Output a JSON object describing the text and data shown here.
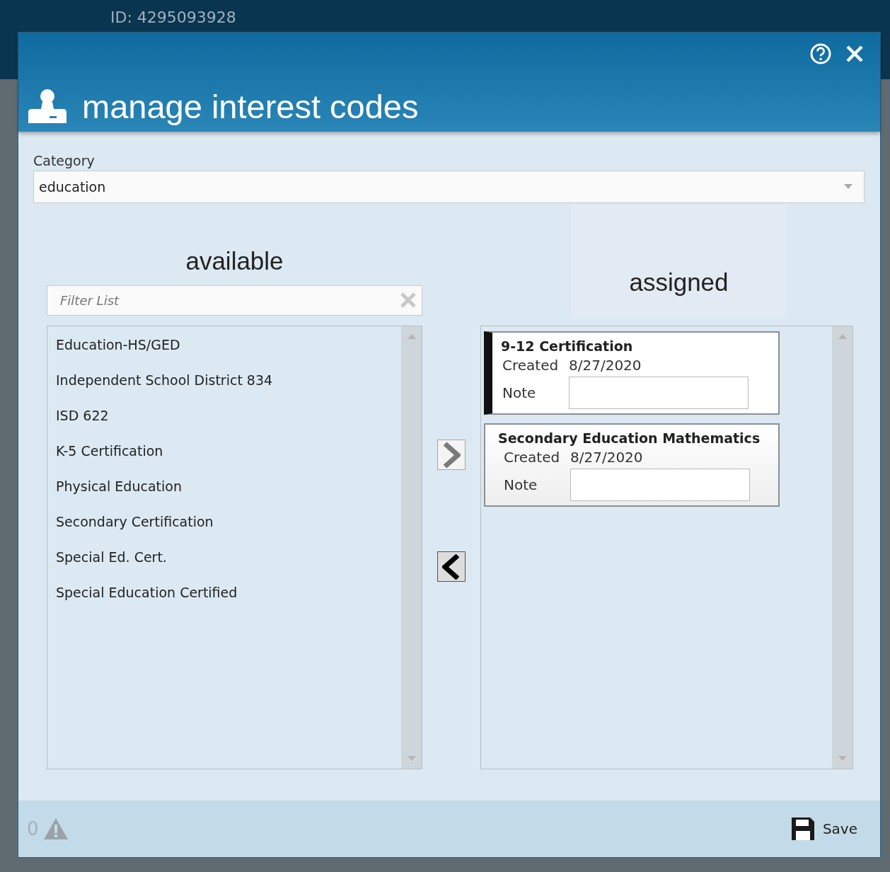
{
  "background": {
    "id_label": "ID: 4295093928"
  },
  "dialog": {
    "title": "manage interest codes"
  },
  "category": {
    "label": "Category",
    "value": "education"
  },
  "available": {
    "heading": "available",
    "filter": {
      "placeholder": "Filter List"
    },
    "items": [
      {
        "name": "Education-HS/GED"
      },
      {
        "name": "Independent School District 834"
      },
      {
        "name": "ISD 622"
      },
      {
        "name": "K-5 Certification"
      },
      {
        "name": "Physical Education"
      },
      {
        "name": "Secondary Certification"
      },
      {
        "name": "Special Ed. Cert."
      },
      {
        "name": "Special Education Certified"
      }
    ]
  },
  "move_right": {
    "disabled": true
  },
  "move_left": {
    "disabled": false
  },
  "assigned": {
    "heading": "assigned",
    "items": [
      {
        "name": "9-12 Certification",
        "created_label": "Created",
        "created": "8/27/2020",
        "note_label": "Note",
        "selected": true
      },
      {
        "name": "Secondary Education Mathematics",
        "created_label": "Created",
        "created": "8/27/2020",
        "note_label": "Note",
        "selected": false
      }
    ]
  },
  "footer": {
    "warning_count": "0",
    "save_label": "Save"
  }
}
